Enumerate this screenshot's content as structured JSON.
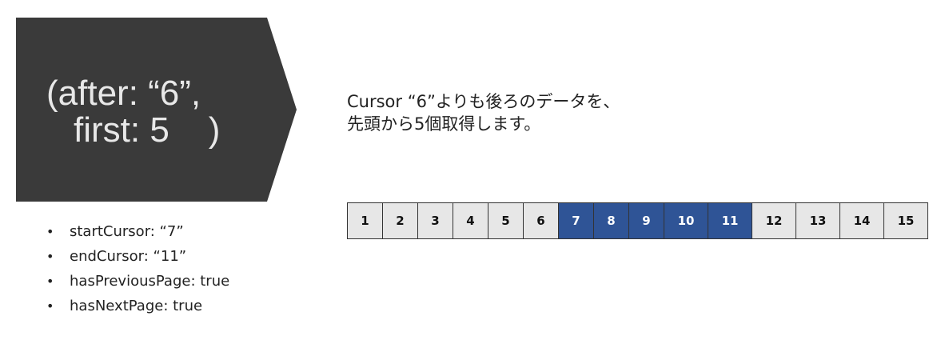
{
  "arrow": {
    "line1": "(after: “6”,",
    "line2": "first: 5    )",
    "fill": "#3a3a3a"
  },
  "description": {
    "line1": "Cursor “6”よりも後ろのデータを、",
    "line2": "先頭から5個取得します。"
  },
  "page_info": [
    {
      "bullet": "•",
      "text": "startCursor: “7”"
    },
    {
      "bullet": "•",
      "text": "endCursor: “11”"
    },
    {
      "bullet": "•",
      "text": "hasPreviousPage: true"
    },
    {
      "bullet": "•",
      "text": "hasNextPage: true"
    }
  ],
  "cells": [
    {
      "label": "1",
      "selected": false
    },
    {
      "label": "2",
      "selected": false
    },
    {
      "label": "3",
      "selected": false
    },
    {
      "label": "4",
      "selected": false
    },
    {
      "label": "5",
      "selected": false
    },
    {
      "label": "6",
      "selected": false
    },
    {
      "label": "7",
      "selected": true
    },
    {
      "label": "8",
      "selected": true
    },
    {
      "label": "9",
      "selected": true
    },
    {
      "label": "10",
      "selected": true
    },
    {
      "label": "11",
      "selected": true
    },
    {
      "label": "12",
      "selected": false
    },
    {
      "label": "13",
      "selected": false
    },
    {
      "label": "14",
      "selected": false
    },
    {
      "label": "15",
      "selected": false
    }
  ],
  "colors": {
    "selected": "#2f5496",
    "unselected": "#e7e7e7"
  }
}
